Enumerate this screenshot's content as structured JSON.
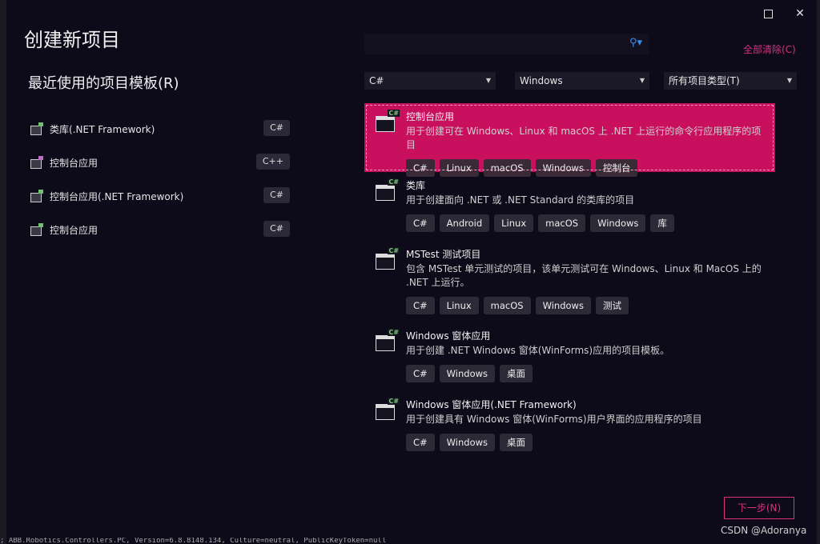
{
  "page_title": "创建新项目",
  "recent_title": "最近使用的项目模板(R)",
  "recent_templates": [
    {
      "label": "类库(.NET Framework)",
      "lang": "C#"
    },
    {
      "label": "控制台应用",
      "lang": "C++"
    },
    {
      "label": "控制台应用(.NET Framework)",
      "lang": "C#"
    },
    {
      "label": "控制台应用",
      "lang": "C#"
    }
  ],
  "search": {
    "placeholder": "",
    "icon": "search-icon"
  },
  "clear_all": "全部清除(C)",
  "filters": {
    "language": "C#",
    "platform": "Windows",
    "project_type": "所有项目类型(T)"
  },
  "templates": [
    {
      "title": "控制台应用",
      "desc": "用于创建可在 Windows、Linux 和 macOS 上 .NET 上运行的命令行应用程序的项目",
      "tags": [
        "C#",
        "Linux",
        "macOS",
        "Windows",
        "控制台"
      ],
      "selected": true
    },
    {
      "title": "类库",
      "desc": "用于创建面向 .NET 或 .NET Standard 的类库的项目",
      "tags": [
        "C#",
        "Android",
        "Linux",
        "macOS",
        "Windows",
        "库"
      ],
      "selected": false
    },
    {
      "title": "MSTest 测试项目",
      "desc": "包含 MSTest 单元测试的项目，该单元测试可在 Windows、Linux 和 MacOS 上的 .NET 上运行。",
      "tags": [
        "C#",
        "Linux",
        "macOS",
        "Windows",
        "测试"
      ],
      "selected": false
    },
    {
      "title": "Windows 窗体应用",
      "desc": "用于创建 .NET Windows 窗体(WinForms)应用的项目模板。",
      "tags": [
        "C#",
        "Windows",
        "桌面"
      ],
      "selected": false
    },
    {
      "title": "Windows 窗体应用(.NET Framework)",
      "desc": "用于创建具有 Windows 窗体(WinForms)用户界面的应用程序的项目",
      "tags": [
        "C#",
        "Windows",
        "桌面"
      ],
      "selected": false
    }
  ],
  "next_button": "下一步(N)",
  "watermark": "CSDN @Adoranya",
  "background_text": "; ABB.Robotics.Controllers.PC, Version=6.8.8148.134, Culture=neutral, PublicKeyToken=null",
  "colors": {
    "accent": "#c8105e",
    "link": "#d8327e",
    "background": "#0d0a1a"
  }
}
